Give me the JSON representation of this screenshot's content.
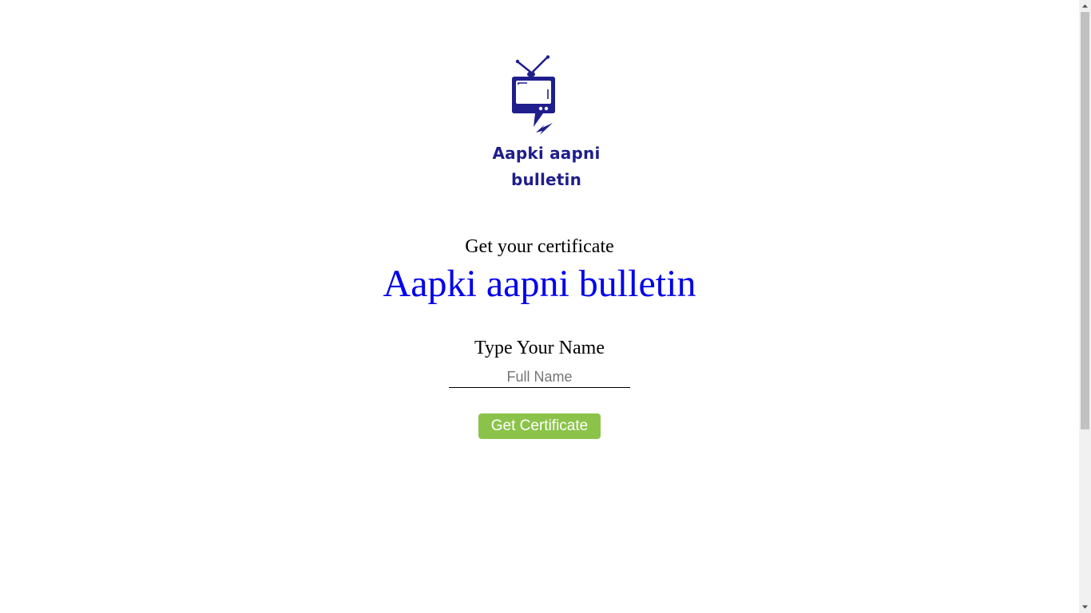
{
  "logo": {
    "line1": "Aapki aapni",
    "line2": "bulletin",
    "icon": "tv-icon",
    "color": "#1f1e8c"
  },
  "header": {
    "subtitle": "Get your certificate",
    "title": "Aapki aapni bulletin",
    "title_color": "#0000ee"
  },
  "form": {
    "label": "Type Your Name",
    "input_placeholder": "Full Name",
    "input_value": "",
    "button_label": "Get Certificate",
    "button_color": "#8bc34a"
  },
  "scrollbar": {
    "up_icon": "scroll-up-arrow-icon",
    "down_icon": "scroll-down-arrow-icon"
  }
}
